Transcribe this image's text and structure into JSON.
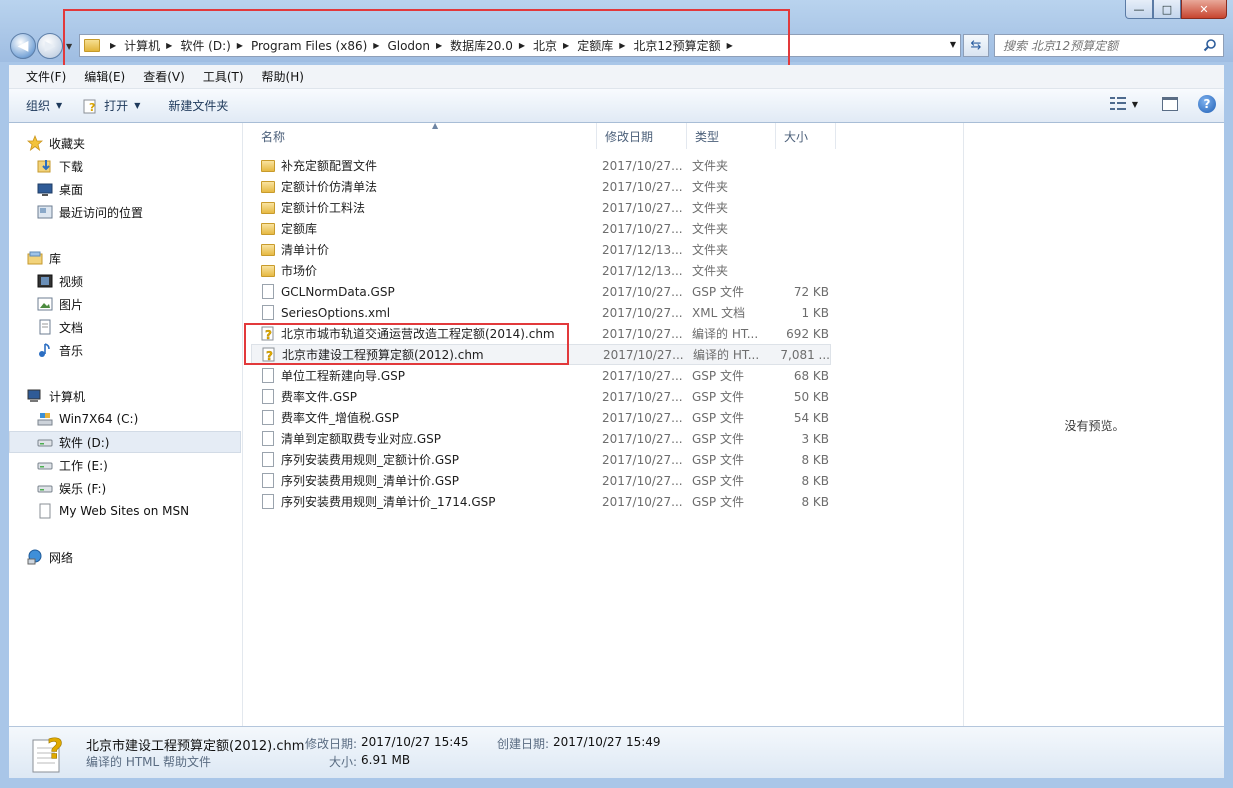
{
  "window": {
    "min_label": "—",
    "max_label": "□",
    "close_label": "✕"
  },
  "address": {
    "crumbs": [
      "计算机",
      "软件 (D:)",
      "Program Files (x86)",
      "Glodon",
      "数据库20.0",
      "北京",
      "定额库",
      "北京12预算定额"
    ]
  },
  "search": {
    "placeholder": "搜索 北京12预算定额"
  },
  "menu": [
    "文件(F)",
    "编辑(E)",
    "查看(V)",
    "工具(T)",
    "帮助(H)"
  ],
  "toolbar": {
    "organize": "组织",
    "open": "打开",
    "new_folder": "新建文件夹"
  },
  "nav": {
    "favorites": "收藏夹",
    "downloads": "下载",
    "desktop": "桌面",
    "recent": "最近访问的位置",
    "library": "库",
    "videos": "视频",
    "pictures": "图片",
    "documents": "文档",
    "music": "音乐",
    "computer": "计算机",
    "drive_c": "Win7X64 (C:)",
    "drive_d": "软件 (D:)",
    "drive_e": "工作 (E:)",
    "drive_f": "娱乐 (F:)",
    "msn": "My Web Sites on MSN",
    "network": "网络"
  },
  "columns": {
    "name": "名称",
    "date": "修改日期",
    "type": "类型",
    "size": "大小"
  },
  "files": [
    {
      "name": "补充定额配置文件",
      "date": "2017/10/27...",
      "type": "文件夹",
      "size": "",
      "kind": "folder"
    },
    {
      "name": "定额计价仿清单法",
      "date": "2017/10/27...",
      "type": "文件夹",
      "size": "",
      "kind": "folder"
    },
    {
      "name": "定额计价工料法",
      "date": "2017/10/27...",
      "type": "文件夹",
      "size": "",
      "kind": "folder"
    },
    {
      "name": "定额库",
      "date": "2017/10/27...",
      "type": "文件夹",
      "size": "",
      "kind": "folder"
    },
    {
      "name": "清单计价",
      "date": "2017/12/13...",
      "type": "文件夹",
      "size": "",
      "kind": "folder"
    },
    {
      "name": "市场价",
      "date": "2017/12/13...",
      "type": "文件夹",
      "size": "",
      "kind": "folder"
    },
    {
      "name": "GCLNormData.GSP",
      "date": "2017/10/27...",
      "type": "GSP 文件",
      "size": "72 KB",
      "kind": "doc"
    },
    {
      "name": "SeriesOptions.xml",
      "date": "2017/10/27...",
      "type": "XML 文档",
      "size": "1 KB",
      "kind": "doc"
    },
    {
      "name": "北京市城市轨道交通运营改造工程定额(2014).chm",
      "date": "2017/10/27...",
      "type": "编译的 HT...",
      "size": "692 KB",
      "kind": "chm"
    },
    {
      "name": "北京市建设工程预算定额(2012).chm",
      "date": "2017/10/27...",
      "type": "编译的 HT...",
      "size": "7,081 ...",
      "kind": "chm"
    },
    {
      "name": "单位工程新建向导.GSP",
      "date": "2017/10/27...",
      "type": "GSP 文件",
      "size": "68 KB",
      "kind": "doc"
    },
    {
      "name": "费率文件.GSP",
      "date": "2017/10/27...",
      "type": "GSP 文件",
      "size": "50 KB",
      "kind": "doc"
    },
    {
      "name": "费率文件_增值税.GSP",
      "date": "2017/10/27...",
      "type": "GSP 文件",
      "size": "54 KB",
      "kind": "doc"
    },
    {
      "name": "清单到定额取费专业对应.GSP",
      "date": "2017/10/27...",
      "type": "GSP 文件",
      "size": "3 KB",
      "kind": "doc"
    },
    {
      "name": "序列安装费用规则_定额计价.GSP",
      "date": "2017/10/27...",
      "type": "GSP 文件",
      "size": "8 KB",
      "kind": "doc"
    },
    {
      "name": "序列安装费用规则_清单计价.GSP",
      "date": "2017/10/27...",
      "type": "GSP 文件",
      "size": "8 KB",
      "kind": "doc"
    },
    {
      "name": "序列安装费用规则_清单计价_1714.GSP",
      "date": "2017/10/27...",
      "type": "GSP 文件",
      "size": "8 KB",
      "kind": "doc"
    }
  ],
  "preview": {
    "empty_text": "没有预览。"
  },
  "details": {
    "file_name": "北京市建设工程预算定额(2012).chm",
    "file_type": "编译的 HTML 帮助文件",
    "modified_label": "修改日期:",
    "modified_value": "2017/10/27 15:45",
    "created_label": "创建日期:",
    "created_value": "2017/10/27 15:49",
    "size_label": "大小:",
    "size_value": "6.91 MB"
  },
  "colors": {
    "highlight": "#e2393b",
    "frame": "#a9c6e8"
  }
}
